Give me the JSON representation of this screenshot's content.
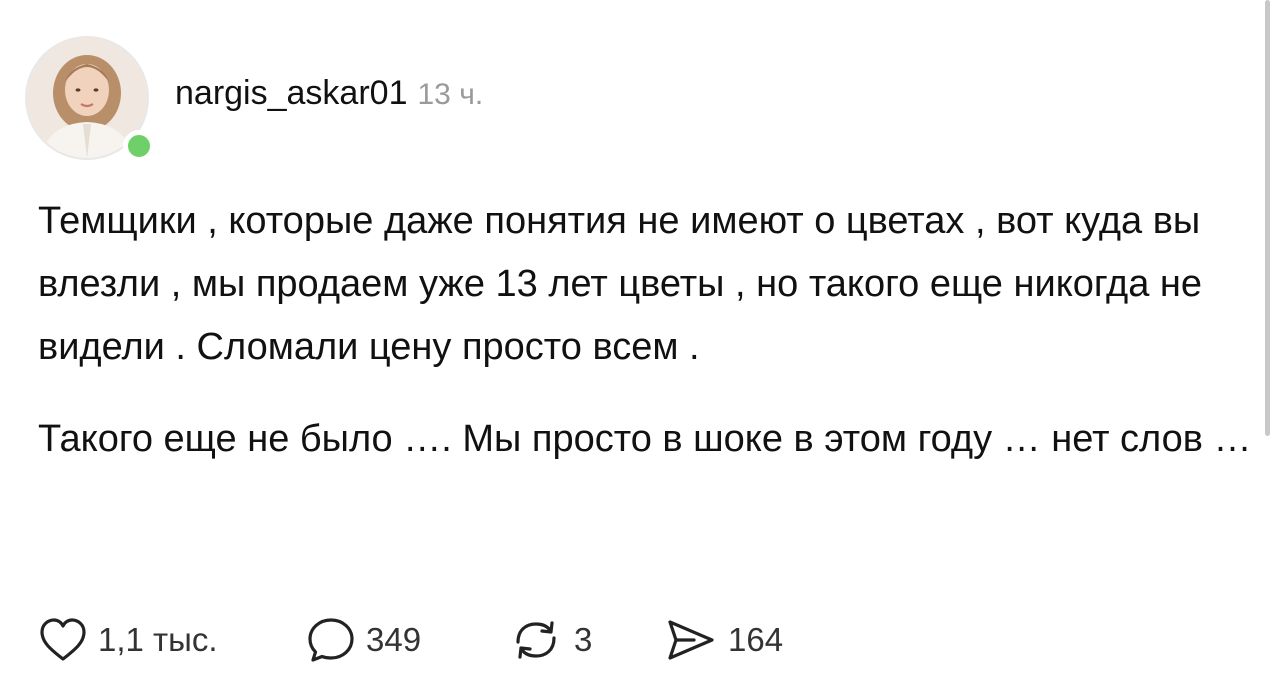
{
  "post": {
    "author": {
      "username": "nargis_askar01",
      "online": true,
      "avatar_icon": "user-avatar-photo"
    },
    "time": "13 ч.",
    "paragraphs": [
      "Темщики , которые даже понятия не имеют о цветах , вот куда вы влезли , мы продаем уже 13 лет цветы , но такого еще никогда не видели . Сломали цену просто всем .",
      "Такого еще не было …. Мы просто в шоке в этом году … нет слов …"
    ],
    "actions": {
      "likes": "1,1 тыс.",
      "comments": "349",
      "reposts": "3",
      "shares": "164"
    }
  },
  "colors": {
    "online": "#6fd06a",
    "text": "#111111",
    "muted": "#9a9a9a"
  }
}
